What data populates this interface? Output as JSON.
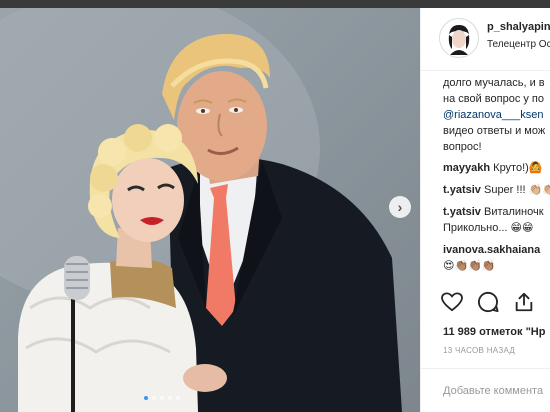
{
  "post": {
    "username": "p_shalyapin",
    "location": "Телецентр Ос",
    "caption_line1": "долго мучалась, и в",
    "caption_line2": "на свой вопрос у по",
    "caption_mention": "@riazanova___ksen",
    "caption_line4": "видео ответы и мож",
    "caption_line5": "вопрос!",
    "likes_count": "11 989",
    "likes_label": "отметок",
    "likes_tail": "\"Нр",
    "time_ago": "13 ЧАСОВ НАЗАД",
    "add_comment_placeholder": "Добавьте коммента"
  },
  "comments": [
    {
      "user": "mayyakh",
      "text": "Круто!)🙆"
    },
    {
      "user": "t.yatsiv",
      "text": "Super !!! 👏🏼👏🏼"
    },
    {
      "user": "t.yatsiv",
      "text": "Виталиночк",
      "text2": "Прикольно... 😁😁"
    },
    {
      "user": "ivanova.sakhaiana",
      "text": "",
      "text2": "😍👏🏽👏🏽👏🏽"
    }
  ],
  "carousel": {
    "slide_count": 5,
    "active_index": 0
  },
  "icons": {
    "like": "heart-icon",
    "comment": "comment-icon",
    "share": "share-icon",
    "next": "chevron-right-icon"
  }
}
